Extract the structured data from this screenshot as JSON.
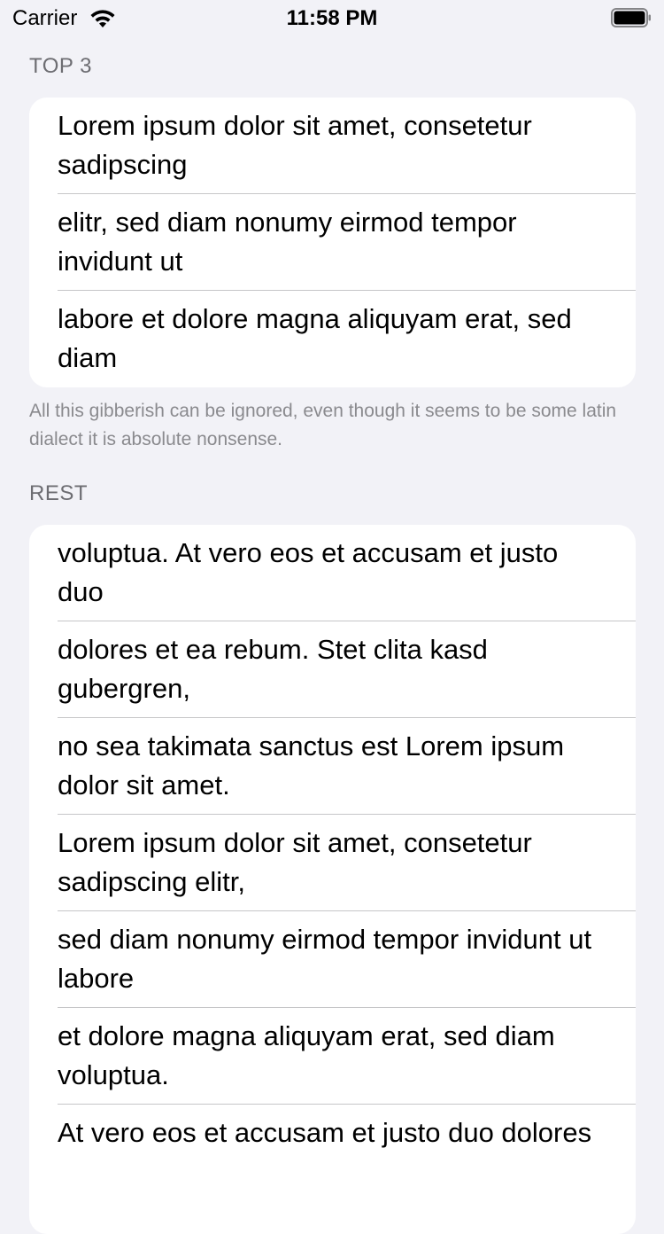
{
  "status_bar": {
    "carrier": "Carrier",
    "time": "11:58 PM"
  },
  "sections": [
    {
      "header": "TOP 3",
      "rows": [
        "Lorem ipsum dolor sit amet, consetetur sadipscing",
        "elitr, sed diam nonumy eirmod tempor invidunt ut",
        "labore et dolore magna aliquyam erat, sed diam"
      ],
      "footer": "All this gibberish can be ignored, even though it seems to be some latin dialect it is absolute nonsense."
    },
    {
      "header": "REST",
      "rows": [
        "voluptua. At vero eos et accusam et justo duo",
        "dolores et ea rebum. Stet clita kasd gubergren,",
        "no sea takimata sanctus est Lorem ipsum dolor sit amet.",
        "Lorem ipsum dolor sit amet, consetetur sadipscing elitr,",
        "sed diam nonumy eirmod tempor invidunt ut labore",
        "et dolore magna aliquyam erat, sed diam voluptua.",
        "At vero eos et accusam et justo duo dolores"
      ]
    }
  ],
  "icons": {
    "wifi": "wifi-icon",
    "battery": "battery-icon"
  }
}
